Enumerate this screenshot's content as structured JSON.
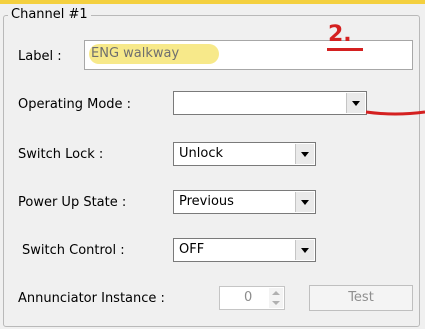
{
  "group": {
    "title": "Channel #1"
  },
  "annotation": {
    "step": "2.",
    "color": "#d42020"
  },
  "highlight_color": "#f7e98a",
  "fields": {
    "label": {
      "caption": "Label :",
      "value": "ENG walkway"
    },
    "operating_mode": {
      "caption": "Operating Mode :",
      "value": ""
    },
    "switch_lock": {
      "caption": "Switch Lock :",
      "value": "Unlock"
    },
    "power_up_state": {
      "caption": "Power Up State :",
      "value": "Previous"
    },
    "switch_control": {
      "caption": "Switch Control :",
      "value": "OFF"
    },
    "annunciator_instance": {
      "caption": "Annunciator Instance :",
      "value": "0"
    }
  },
  "buttons": {
    "test": "Test"
  }
}
